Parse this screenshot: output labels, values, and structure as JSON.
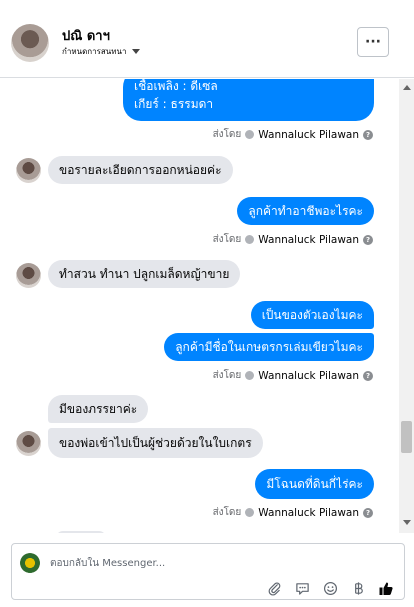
{
  "header": {
    "name": "ปณิ ดาฯ",
    "subtitle": "กำหนดการสนทนา",
    "more_label": "···"
  },
  "messages": {
    "m1": {
      "line1": "เชื้อเพลิง : ดีเซล",
      "line2": "เกียร์ : ธรรมดา"
    },
    "m2": "ขอรายละเอียดการออกหน่อยค่ะ",
    "m3": "ลูกค้าทำอาชีพอะไรคะ",
    "m4": "ทำสวน ทำนา ปลูกเมล็ดหญ้าขาย",
    "m5": "เป็นของตัวเองไมคะ",
    "m6": "ลูกค้ามีชื่อในเกษตรกรเล่มเขียวไมคะ",
    "m7": "มีของภรรยาค่ะ",
    "m8": "ของพ่อเข้าไปเป็นผู้ช่วยด้วยในใบเกตร",
    "m9": "มีโฉนดที่ดินกี่ไร่คะ"
  },
  "sender": {
    "prefix": "ส่งโดย",
    "name": "Wannaluck Pilawan",
    "help": "?"
  },
  "composer": {
    "placeholder": "ตอบกลับใน Messenger..."
  },
  "icons": {
    "attach": "paperclip-icon",
    "gif": "chat-icon",
    "emoji": "emoji-icon",
    "payment": "baht-icon",
    "like": "thumbs-up-icon"
  },
  "colors": {
    "outgoing_bubble": "#0084ff",
    "incoming_bubble": "#e4e6eb"
  }
}
